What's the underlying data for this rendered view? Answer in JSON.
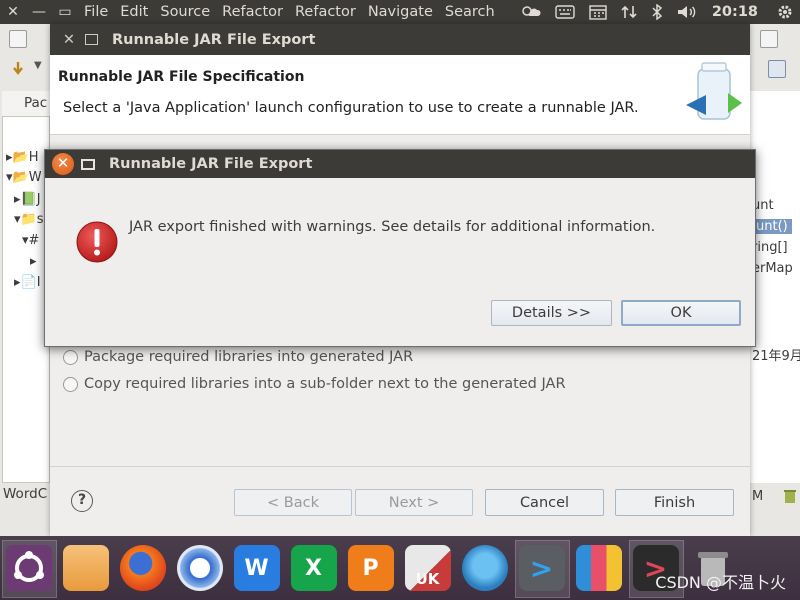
{
  "top_panel": {
    "window_close": "✕",
    "window_min": "—",
    "window_max": "▭",
    "menus": [
      "File",
      "Edit",
      "Source",
      "Refactor",
      "Refactor",
      "Navigate",
      "Search"
    ],
    "clock": "20:18"
  },
  "eclipse": {
    "package_tab_label": "Pac",
    "tree_rows": [
      "H",
      "W",
      "J",
      "s",
      "#",
      "",
      "I"
    ],
    "word_label": "WordC",
    "right_texts": [
      "unt",
      "unt()",
      "ring[]",
      "erMap",
      "21年9月",
      "M"
    ]
  },
  "wizard": {
    "title": "Runnable JAR File Export",
    "banner_title": "Runnable JAR File Specification",
    "banner_desc": "Select a 'Java Application' launch configuration to use to create a runnable JAR.",
    "options": [
      "Package required libraries into generated JAR",
      "Copy required libraries into a sub-folder next to the generated JAR"
    ],
    "help": "?",
    "buttons": {
      "back": "< Back",
      "next": "Next >",
      "cancel": "Cancel",
      "finish": "Finish"
    }
  },
  "alert": {
    "title": "Runnable JAR File Export",
    "message": "JAR export finished with warnings. See details for additional information.",
    "details_button": "Details >>",
    "ok_button": "OK",
    "close_glyph": "✕",
    "icon_glyph": "!"
  },
  "dock": {
    "items": [
      {
        "name": "ubuntu-logo-icon",
        "label": ""
      },
      {
        "name": "files-icon",
        "label": ""
      },
      {
        "name": "firefox-icon",
        "label": ""
      },
      {
        "name": "browser-icon",
        "label": ""
      },
      {
        "name": "wps-writer-icon",
        "label": "W"
      },
      {
        "name": "wps-spreadsheet-icon",
        "label": "X"
      },
      {
        "name": "wps-presentation-icon",
        "label": "P"
      },
      {
        "name": "software-updater-icon",
        "label": "UK"
      },
      {
        "name": "app-icon",
        "label": ""
      },
      {
        "name": "vscode-icon",
        "label": ">"
      },
      {
        "name": "screenshot-icon",
        "label": ""
      },
      {
        "name": "terminal-icon",
        "label": ">"
      },
      {
        "name": "trash-icon",
        "label": ""
      }
    ],
    "watermark": "CSDN @不温卜火"
  },
  "colors": {
    "panel": "#3c3b37",
    "dock": "#3d2f3f",
    "close_orange": "#e05a14",
    "warning_red": "#d12d2d",
    "button_border": "#a9b6c4"
  }
}
